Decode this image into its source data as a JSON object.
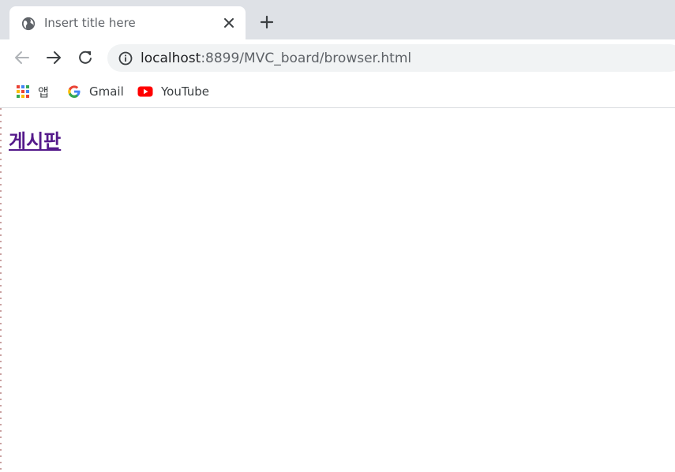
{
  "tab": {
    "title": "Insert title here",
    "favicon": "globe-icon"
  },
  "toolbar": {
    "url_host": "localhost",
    "url_path": ":8899/MVC_board/browser.html"
  },
  "bookmarks": [
    {
      "label": "앱",
      "icon": "apps-grid-icon"
    },
    {
      "label": "Gmail",
      "icon": "google-g-icon"
    },
    {
      "label": "YouTube",
      "icon": "youtube-icon"
    }
  ],
  "page": {
    "link_text": "게시판"
  },
  "colors": {
    "tabstrip_bg": "#dee1e6",
    "omnibox_bg": "#f1f3f4",
    "visited_link": "#551a8b",
    "youtube_red": "#ff0000"
  }
}
